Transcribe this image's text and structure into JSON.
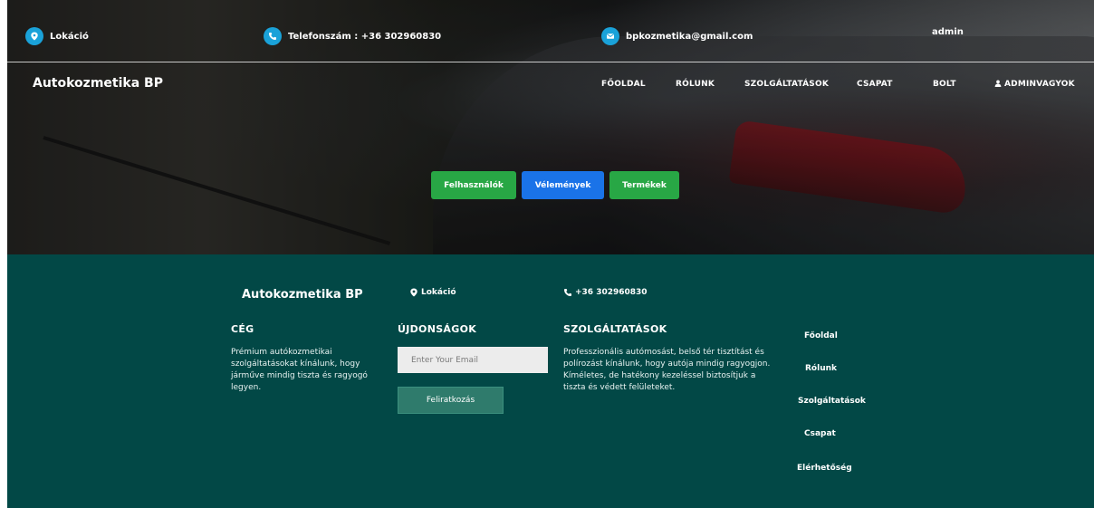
{
  "topbar": {
    "location": "Lokáció",
    "phone": "Telefonszám : +36 302960830",
    "email": "bpkozmetika@gmail.com",
    "user": "admin"
  },
  "navbar": {
    "brand": "Autokozmetika BP",
    "links": [
      "FŐOLDAL",
      "RÓLUNK",
      "SZOLGÁLTATÁSOK",
      "CSAPAT",
      "BOLT",
      "ADMINVAGYOK"
    ]
  },
  "admin_buttons": {
    "users": "Felhasználók",
    "reviews": "Vélemények",
    "products": "Termékek"
  },
  "footer": {
    "brand": "Autokozmetika BP",
    "location": "Lokáció",
    "phone": "+36 302960830",
    "company_heading": "CÉG",
    "company_text": "Prémium autókozmetikai szolgáltatásokat kínálunk, hogy járműve mindig tiszta és ragyogó legyen.",
    "news_heading": "ÚJDONSÁGOK",
    "email_placeholder": "Enter Your Email",
    "subscribe": "Feliratkozás",
    "services_heading": "SZOLGÁLTATÁSOK",
    "services_text": "Professzionális autómosást, belső tér tisztítást és polírozást kínálunk, hogy autója mindig ragyogjon. Kíméletes, de hatékony kezeléssel biztosítjuk a tiszta és védett felületeket.",
    "links": [
      "Főoldal",
      "Rólunk",
      "Szolgáltatások",
      "Csapat",
      "Elérhetőség"
    ]
  },
  "colors": {
    "footer_bg": "#024846",
    "icon_blue": "#1aa2d9",
    "green": "#28a745",
    "blue": "#1a73e8"
  }
}
